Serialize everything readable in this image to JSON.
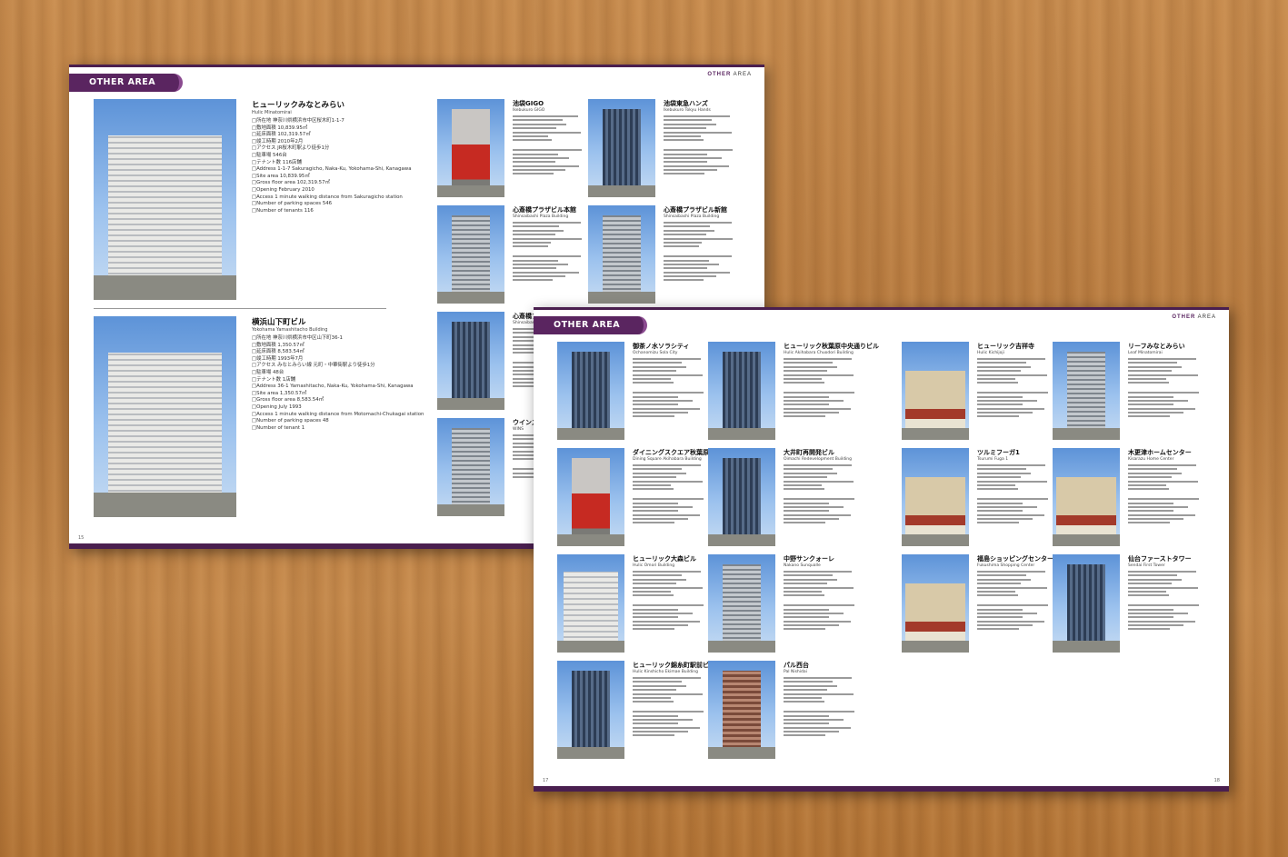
{
  "back_spread": {
    "tab": "OTHER AREA",
    "area_label_accent": "OTHER",
    "area_label_rest": " AREA",
    "page_number": "15",
    "featured": [
      {
        "name_ja": "ヒューリックみなとみらい",
        "name_en": "Hulic Minatomirai",
        "details_ja": [
          "□所在地 神奈川県横浜市中区桜木町1-1-7",
          "□敷地面積 10,839.95㎡",
          "□延床面積 102,319.57㎡",
          "□竣工時期 2010年2月",
          "□アクセス JR桜木町駅より徒歩1分",
          "□駐車場 546台",
          "□テナント数 116店舗"
        ],
        "details_en": [
          "□Address 1-1-7 Sakuragicho, Naka-Ku, Yokohama-Shi, Kanagawa",
          "□Site area 10,839.95㎡",
          "□Gross floor area 102,319.57㎡",
          "□Opening February 2010",
          "□Access 1 minute walking distance from Sakuragicho station",
          "□Number of parking spaces 546",
          "□Number of tenants 116"
        ]
      },
      {
        "name_ja": "横浜山下町ビル",
        "name_en": "Yokohama Yamashitacho Building",
        "details_ja": [
          "□所在地 神奈川県横浜市中区山下町36-1",
          "□敷地面積 1,350.57㎡",
          "□延床面積 8,583.54㎡",
          "□竣工時期 1993年7月",
          "□アクセス みなとみらい線 元町・中華街駅より徒歩1分",
          "□駐車場 48台",
          "□テナント数 1店舗"
        ],
        "details_en": [
          "□Address 36-1 Yamashitacho, Naka-Ku, Yokohama-Shi, Kanagawa",
          "□Site area 1,350.57㎡",
          "□Gross floor area 8,583.54㎡",
          "□Opening July 1993",
          "□Access 1 minute walking distance from Motomachi-Chukagai station",
          "□Number of parking spaces 48",
          "□Number of tenant 1"
        ]
      }
    ],
    "grid": [
      {
        "name_ja": "池袋GIGO",
        "name_en": "Ikebukuro GIGO"
      },
      {
        "name_ja": "池袋東急ハンズ",
        "name_en": "Ikebukuro Tokyu Hands"
      },
      {
        "name_ja": "心斎橋プラザビル本館",
        "name_en": "Shinsaibashi Plaza Building"
      },
      {
        "name_ja": "心斎橋プラザビル新館",
        "name_en": "Shinsaibashi Plaza Building"
      },
      {
        "name_ja": "心斎橋プ",
        "name_en": "Shinsaibashi"
      },
      {
        "name_ja": "ウインズ",
        "name_en": "WINS"
      }
    ]
  },
  "front_spread": {
    "tab": "OTHER AREA",
    "area_label_accent": "OTHER",
    "area_label_rest": " AREA",
    "page_left": "17",
    "page_right": "18",
    "entries": [
      {
        "name_ja": "御茶ノ水ソラシティ",
        "name_en": "Ochanomizu Sola City"
      },
      {
        "name_ja": "ヒューリック秋葉原中央通りビル",
        "name_en": "Hulic Akihabara Chuodori Building"
      },
      {
        "name_ja": "ダイニングスクエア秋葉原ビル",
        "name_en": "Dining Square Akihabara Building"
      },
      {
        "name_ja": "大井町再開発ビル",
        "name_en": "Oimachi Redevelopment Building"
      },
      {
        "name_ja": "ヒューリック大森ビル",
        "name_en": "Hulic Omori Building"
      },
      {
        "name_ja": "中野サンクォーレ",
        "name_en": "Nakano Sunqualle"
      },
      {
        "name_ja": "ヒューリック錦糸町駅前ビル",
        "name_en": "Hulic Kinshicho Ekimae Building"
      },
      {
        "name_ja": "パル西台",
        "name_en": "Pal Nishidai"
      },
      {
        "name_ja": "ヒューリック吉祥寺",
        "name_en": "Hulic Kichijoji"
      },
      {
        "name_ja": "リーフみなとみらい",
        "name_en": "Leaf Minatomirai"
      },
      {
        "name_ja": "ツルミフーガ1",
        "name_en": "Tsurumi Fuga 1"
      },
      {
        "name_ja": "木更津ホームセンター",
        "name_en": "Kisarazu Home Center"
      },
      {
        "name_ja": "福島ショッピングセンター",
        "name_en": "Fukushima Shopping Center"
      },
      {
        "name_ja": "仙台ファーストタワー",
        "name_en": "Sendai First Tower"
      }
    ]
  },
  "colors": {
    "purple": "#5a2560",
    "wood": "#c28446"
  }
}
